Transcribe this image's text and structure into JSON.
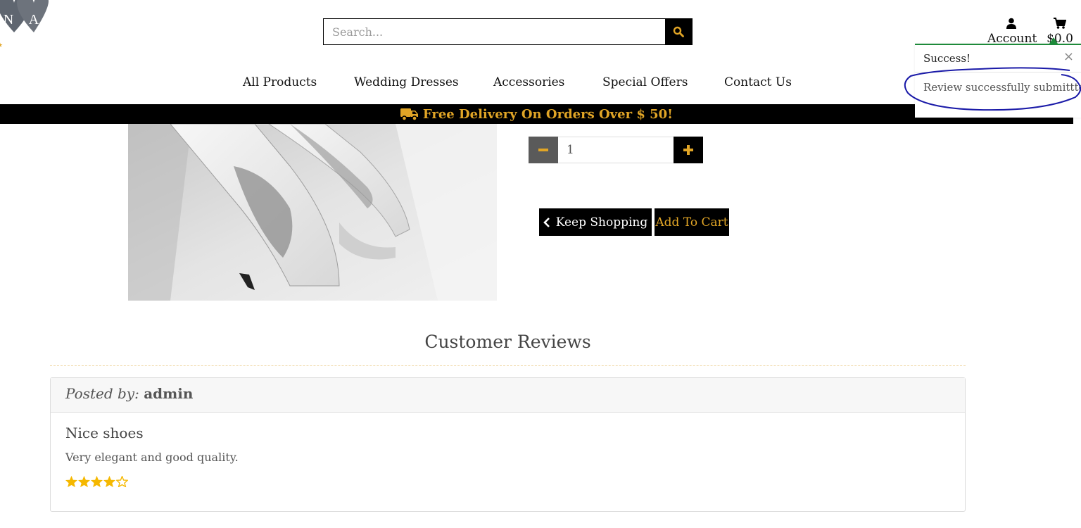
{
  "logo": {
    "letters": [
      "N",
      "A"
    ]
  },
  "search": {
    "placeholder": "Search..."
  },
  "header": {
    "account_label": "Account",
    "cart_total": "$0.0"
  },
  "nav": {
    "items": [
      {
        "label": "All Products"
      },
      {
        "label": "Wedding Dresses"
      },
      {
        "label": "Accessories"
      },
      {
        "label": "Special Offers"
      },
      {
        "label": "Contact Us"
      }
    ]
  },
  "banner": {
    "text": "Free Delivery On Orders Over $ 50!"
  },
  "product": {
    "quantity": "1"
  },
  "buttons": {
    "keep_shopping": "Keep Shopping",
    "add_to_cart": "Add To Cart"
  },
  "reviews": {
    "title": "Customer Reviews",
    "items": [
      {
        "posted_by_label": "Posted by:",
        "author": "admin",
        "title": "Nice shoes",
        "text": "Very elegant and good quality.",
        "rating": 4,
        "max_rating": 5
      }
    ]
  },
  "toast": {
    "title": "Success!",
    "message": "Review successfully submittted!",
    "close_glyph": "×"
  },
  "colors": {
    "accent_gold": "#e1a526",
    "success_green": "#1e8a3a",
    "star": "#f5b800",
    "annotation_blue": "#1a1aa8"
  }
}
